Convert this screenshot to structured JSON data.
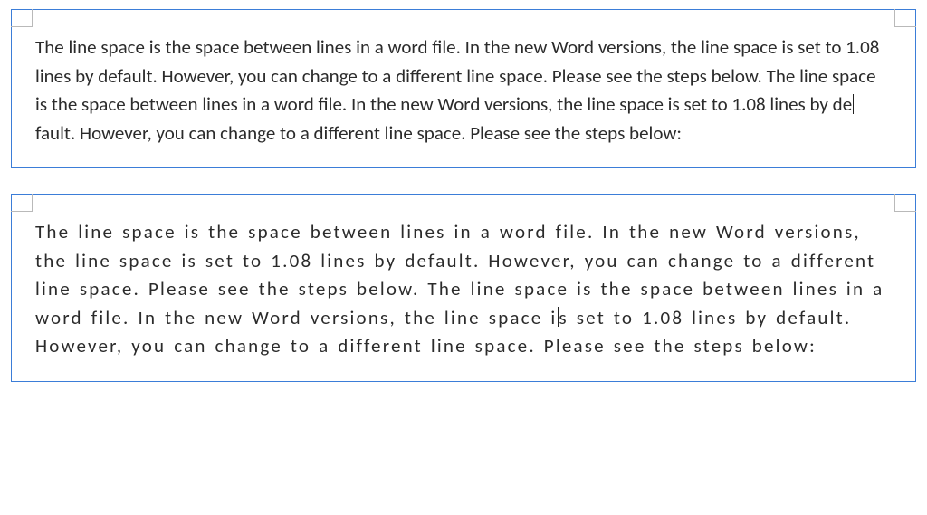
{
  "frame1": {
    "text_before_cursor": "The line space is the space between lines in a word file. In the new Word versions, the line space is set to 1.08 lines by default. However, you can change to a different line space. Please see the steps below. The line space is the space between lines in a word file. In the new Word versions, the line space is set to 1.08 lines by de",
    "text_after_cursor": "fault. However, you can change to a different line space. Please see the steps below:"
  },
  "frame2": {
    "text_before_cursor": "The line space is the space between lines in a word file. In the new Word versions, the line space is set to 1.08 lines by default. However, you can change to a different line space. Please see the steps below. The line space is the space between lines in a word file. In the new Word versions, the line space i",
    "text_after_cursor": "s set to 1.08 lines by default. However, you can change to a different line space. Please see the steps below:"
  }
}
